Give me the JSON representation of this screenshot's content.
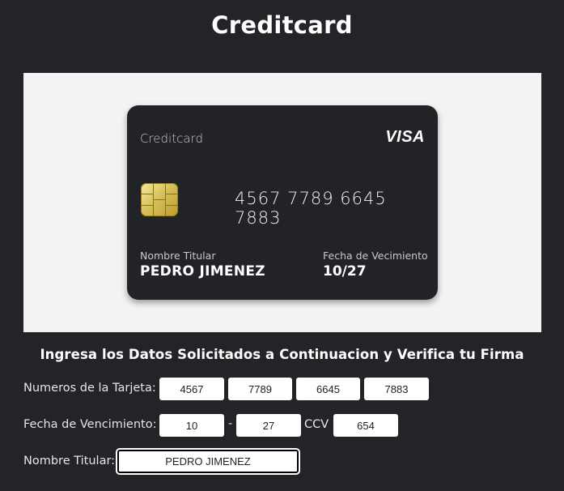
{
  "page": {
    "title": "Creditcard"
  },
  "card": {
    "brand_label": "Creditcard",
    "network": "VISA",
    "number": "4567 7789 6645 7883",
    "holder_caption": "Nombre Titular",
    "holder_name": "PEDRO JIMENEZ",
    "expiry_caption": "Fecha de Vecimiento",
    "expiry": "10/27"
  },
  "form": {
    "instructions": "Ingresa los Datos Solicitados a Continuacion y Verifica tu Firma",
    "number_label": "Numeros de la Tarjeta:",
    "number_parts": [
      "4567",
      "7789",
      "6645",
      "7883"
    ],
    "expiry_label": "Fecha de Vencimiento:",
    "expiry_month": "10",
    "expiry_separator": "-",
    "expiry_year": "27",
    "ccv_label": "CCV",
    "ccv": "654",
    "holder_label": "Nombre Titular:",
    "holder_name": "PEDRO JIMENEZ"
  },
  "colors": {
    "background": "#222427",
    "card": "#222326",
    "panel": "#f3f3f3",
    "chip": "#d9c25a"
  }
}
